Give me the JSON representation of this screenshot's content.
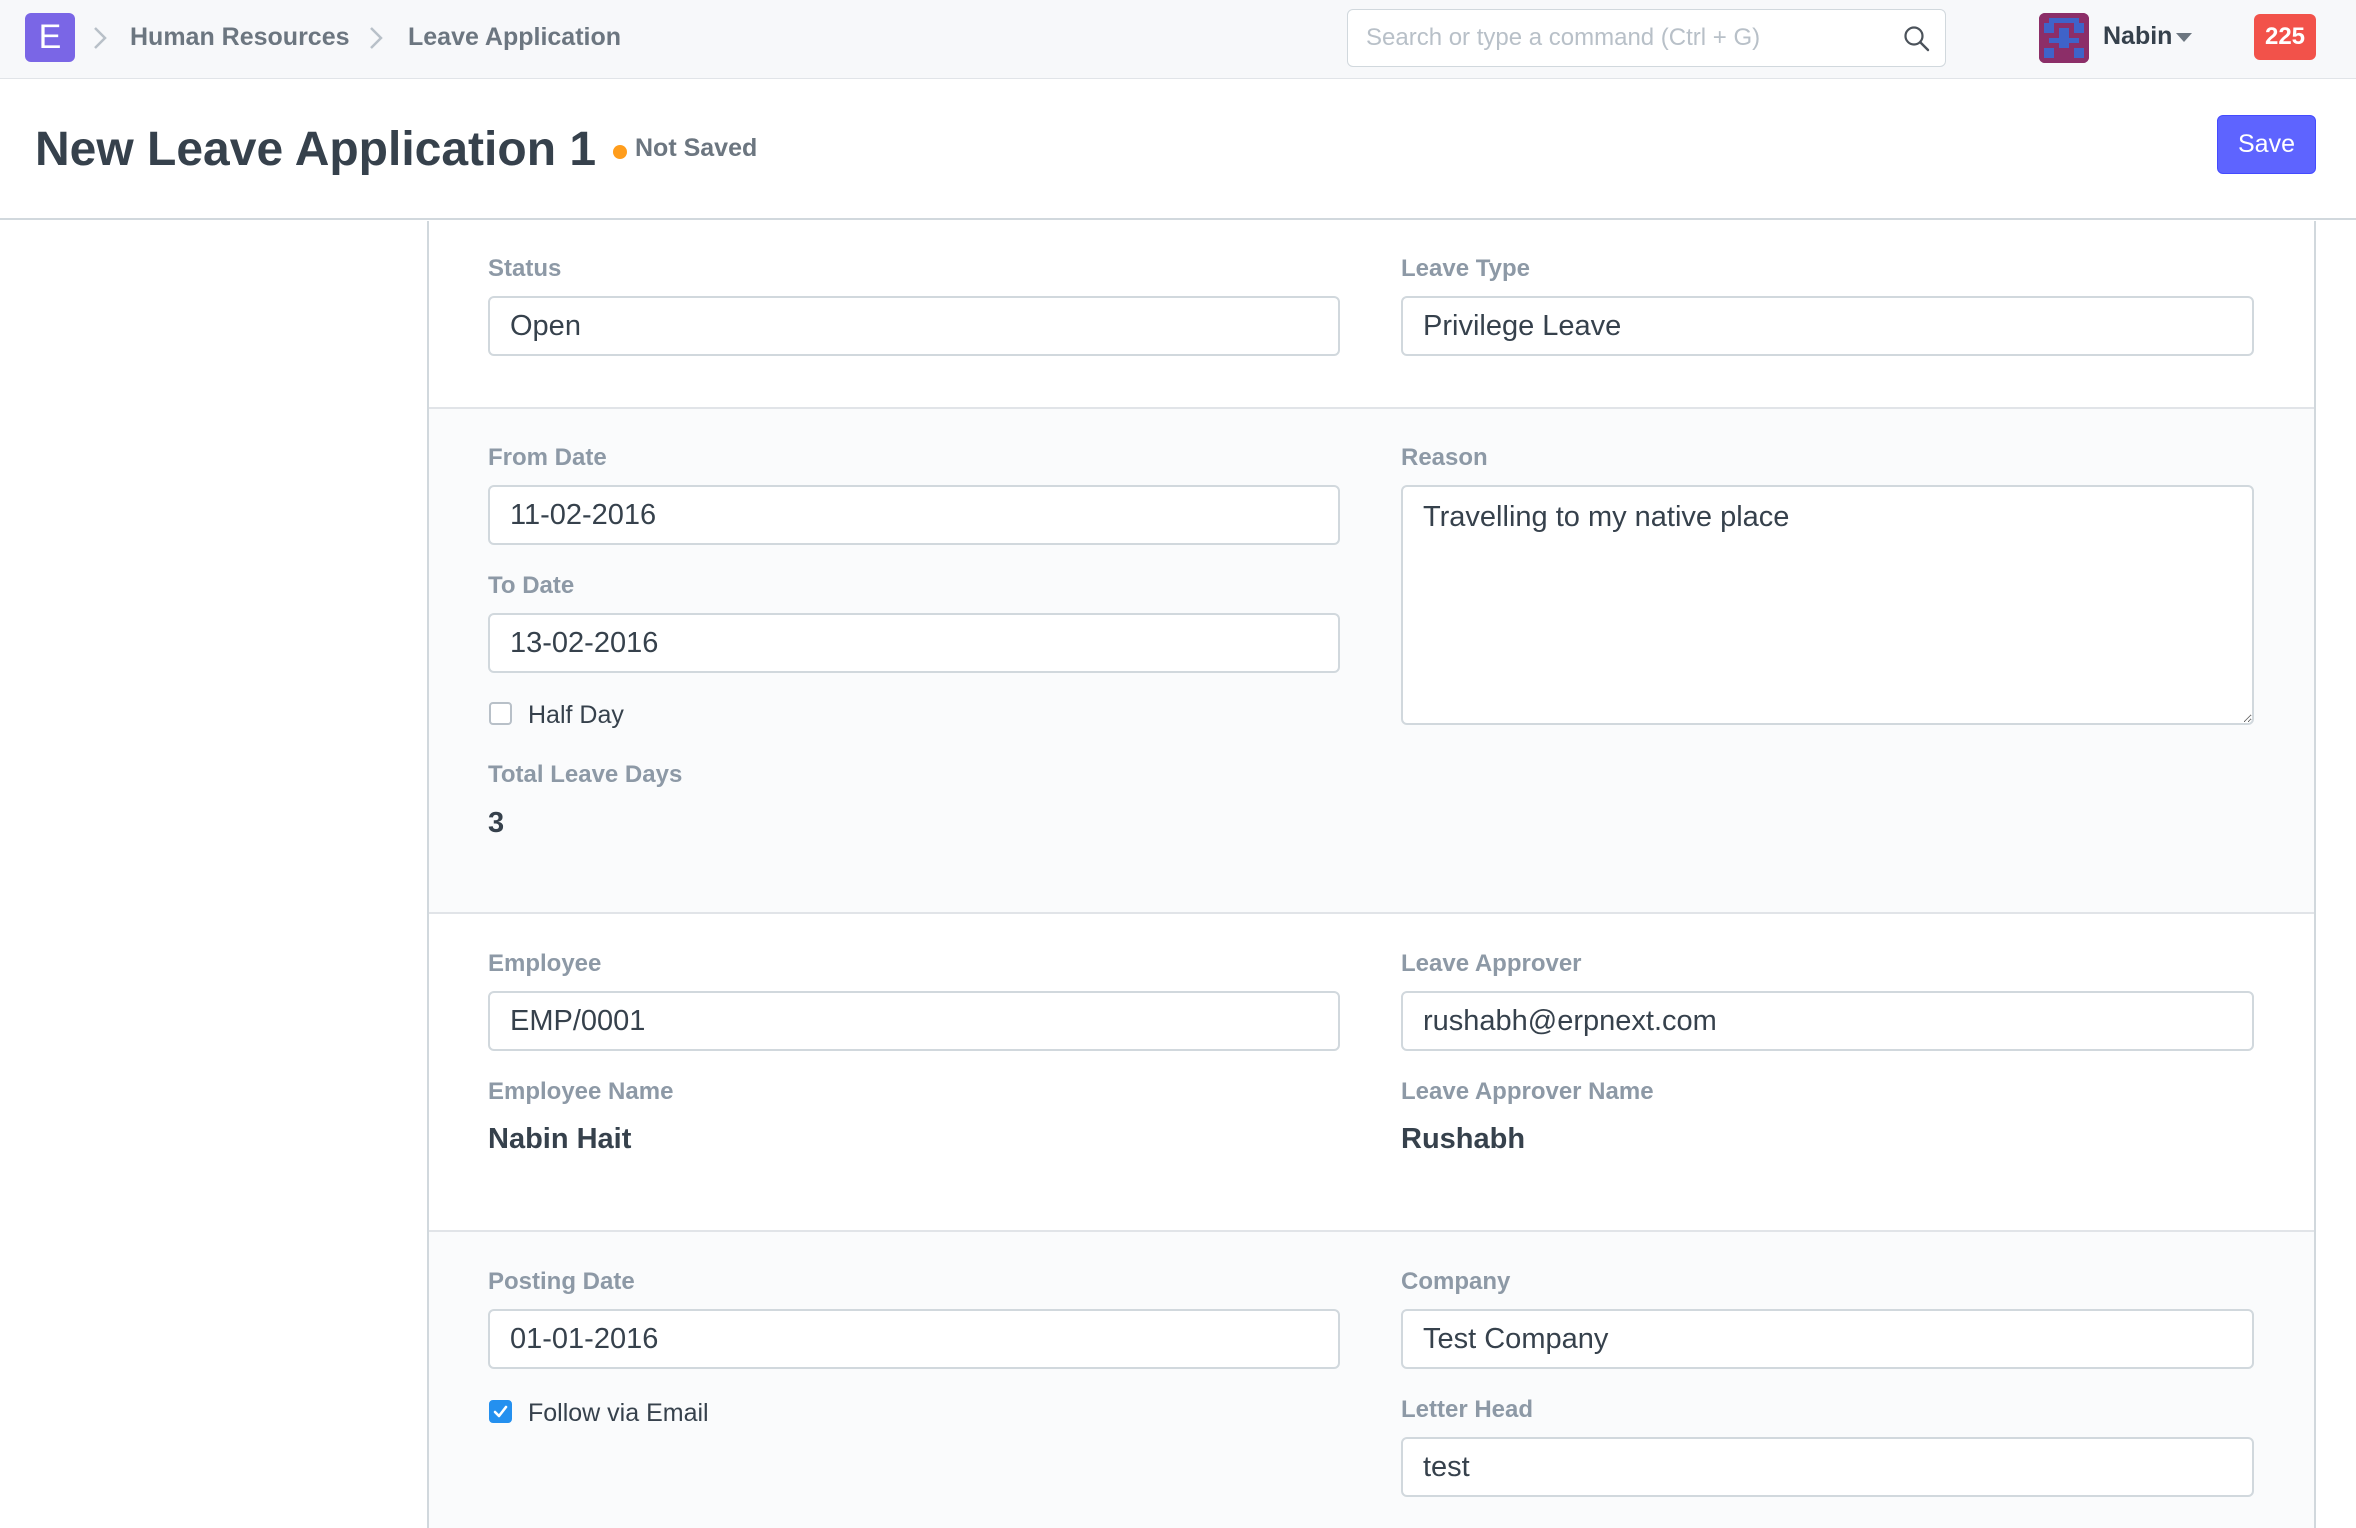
{
  "navbar": {
    "logo_letter": "E",
    "breadcrumbs": [
      "Human Resources",
      "Leave Application"
    ],
    "search_placeholder": "Search or type a command (Ctrl + G)",
    "user_name": "Nabin",
    "notification_count": "225"
  },
  "page": {
    "title": "New Leave Application 1",
    "status": "Not Saved",
    "save_label": "Save"
  },
  "form": {
    "status_label": "Status",
    "status_value": "Open",
    "leave_type_label": "Leave Type",
    "leave_type_value": "Privilege Leave",
    "from_date_label": "From Date",
    "from_date_value": "11-02-2016",
    "to_date_label": "To Date",
    "to_date_value": "13-02-2016",
    "half_day_label": "Half Day",
    "half_day_checked": false,
    "total_leave_days_label": "Total Leave Days",
    "total_leave_days_value": "3",
    "reason_label": "Reason",
    "reason_value": "Travelling to my native place",
    "employee_label": "Employee",
    "employee_value": "EMP/0001",
    "employee_name_label": "Employee Name",
    "employee_name_value": "Nabin Hait",
    "leave_approver_label": "Leave Approver",
    "leave_approver_value": "rushabh@erpnext.com",
    "leave_approver_name_label": "Leave Approver Name",
    "leave_approver_name_value": "Rushabh",
    "posting_date_label": "Posting Date",
    "posting_date_value": "01-01-2016",
    "follow_via_email_label": "Follow via Email",
    "follow_via_email_checked": true,
    "company_label": "Company",
    "company_value": "Test Company",
    "letter_head_label": "Letter Head",
    "letter_head_value": "test"
  },
  "colors": {
    "primary": "#5e64ff",
    "logo": "#7a66e6",
    "notification": "#f2524a",
    "indicator_orange": "#ff9d1c",
    "checkbox_blue": "#2490ef"
  },
  "icons": [
    "chevron-right-icon",
    "search-icon",
    "user-avatar",
    "caret-down-icon",
    "check-icon"
  ]
}
